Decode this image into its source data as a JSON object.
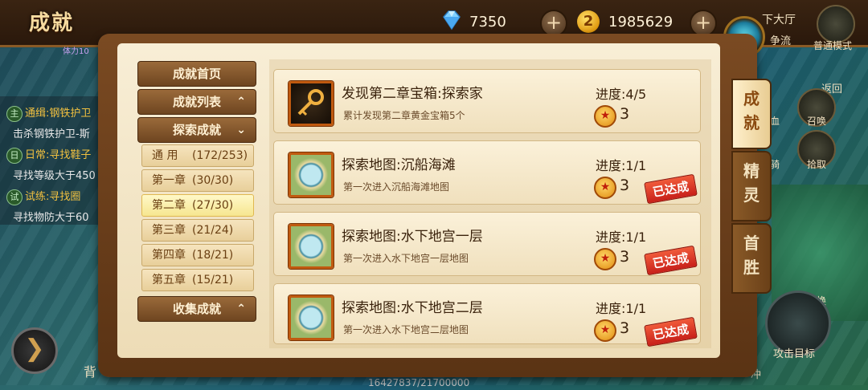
{
  "header": {
    "title": "成就",
    "diamonds": "7350",
    "gold": "1985629",
    "add_symbol": "+",
    "coin_symbol": "2"
  },
  "hud_left": {
    "hp_text": "体力10",
    "quests": [
      {
        "tag": "主",
        "title": "通缉:钢铁护卫",
        "desc": "击杀钢铁护卫-斯"
      },
      {
        "tag": "日",
        "title": "日常:寻找鞋子",
        "desc": "寻找等级大于450"
      },
      {
        "tag": "试",
        "title": "试练:寻找圈",
        "desc": "寻找物防大于60"
      }
    ],
    "arrow": "❯",
    "bag": "背",
    "exp": "16427837/21700000"
  },
  "hud_right": {
    "hall": "下大厅",
    "contest": "争流",
    "mode": "普通模式",
    "back": "返回",
    "blood": "血",
    "summon": "召唤",
    "ride": "骑",
    "pickup": "拾取",
    "switch": "切换",
    "attack": "攻击目标",
    "pk": "冲"
  },
  "nav": {
    "home": "成就首页",
    "list": "成就列表",
    "explore": "探索成就",
    "collect": "收集成就",
    "chev_up": "⌃",
    "chev_down": "⌄",
    "sub": [
      {
        "name": "通  用",
        "count": "(172/253)"
      },
      {
        "name": "第一章",
        "count": "(30/30)"
      },
      {
        "name": "第二章",
        "count": "(27/30)"
      },
      {
        "name": "第三章",
        "count": "(21/24)"
      },
      {
        "name": "第四章",
        "count": "(18/21)"
      },
      {
        "name": "第五章",
        "count": "(15/21)"
      }
    ]
  },
  "achievements": [
    {
      "title": "发现第二章宝箱:探索家",
      "desc": "累计发现第二章黄金宝箱5个",
      "progress": "进度:4/5",
      "reward": "3",
      "done": ""
    },
    {
      "title": "探索地图:沉船海滩",
      "desc": "第一次进入沉船海滩地图",
      "progress": "进度:1/1",
      "reward": "3",
      "done": "已达成"
    },
    {
      "title": "探索地图:水下地宫一层",
      "desc": "第一次进入水下地宫一层地图",
      "progress": "进度:1/1",
      "reward": "3",
      "done": "已达成"
    },
    {
      "title": "探索地图:水下地宫二层",
      "desc": "第一次进入水下地宫二层地图",
      "progress": "进度:1/1",
      "reward": "3",
      "done": "已达成"
    }
  ],
  "tabs": {
    "t1": "成就",
    "t2": "精灵",
    "t3": "首胜"
  }
}
